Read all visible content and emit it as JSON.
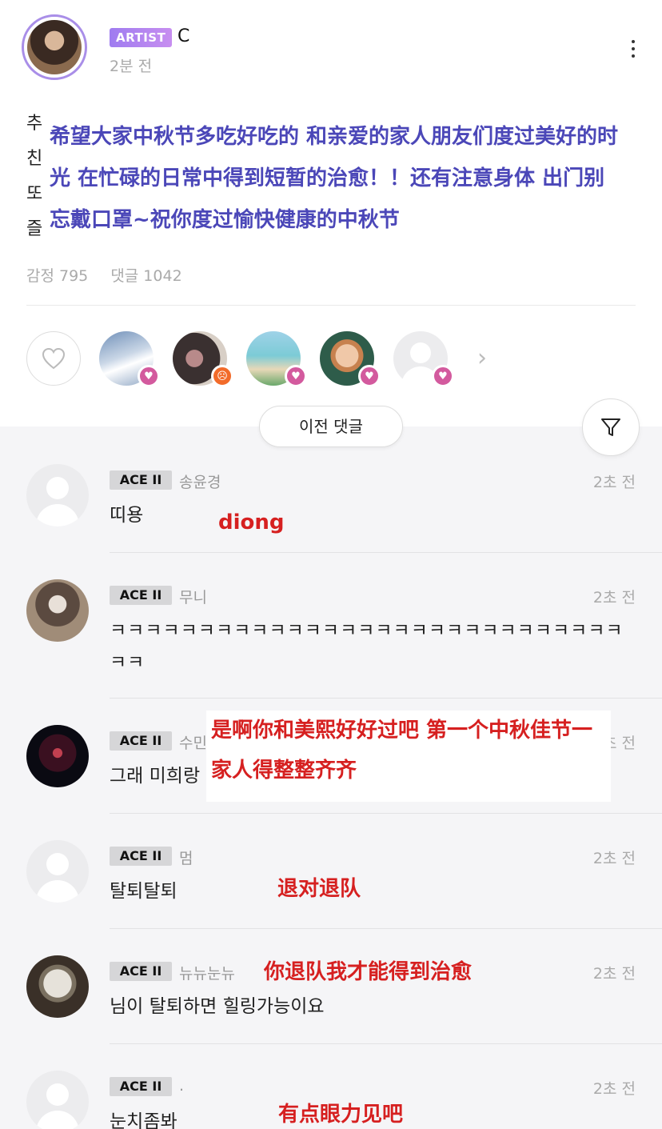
{
  "post": {
    "badge": "ARTIST",
    "author": "C",
    "time": "2분 전",
    "korean_chars": [
      "추",
      "친",
      "또",
      "즐"
    ],
    "translation": "希望大家中秋节多吃好吃的 和亲爱的家人朋友们度过美好的时光 在忙碌的日常中得到短暂的治愈！！还有注意身体 出门别忘戴口罩~祝你度过愉快健康的中秋节",
    "reactions_label": "감정 795",
    "comments_label": "댓글 1042"
  },
  "controls": {
    "previous_comments": "이전 댓글"
  },
  "comments": [
    {
      "level": "ACE II",
      "nick": "송윤경",
      "time": "2초 전",
      "text": "띠용",
      "note": "diong"
    },
    {
      "level": "ACE II",
      "nick": "무니",
      "time": "2초 전",
      "text": "ㅋㅋㅋㅋㅋㅋㅋㅋㅋㅋㅋㅋㅋㅋㅋㅋㅋㅋㅋㅋㅋㅋㅋㅋㅋㅋㅋㅋㅋㅋㅋ"
    },
    {
      "level": "ACE II",
      "nick": "수민",
      "time": "2초 전",
      "text": "그래 미희랑",
      "note": "是啊你和美熙好好过吧 第一个中秋佳节一家人得整整齐齐"
    },
    {
      "level": "ACE II",
      "nick": "멈",
      "time": "2초 전",
      "text": "탈퇴탈퇴",
      "note": "退对退队"
    },
    {
      "level": "ACE II",
      "nick": "뉴뉴눈뉴",
      "time": "2초 전",
      "text": "님이 탈퇴하면 힐링가능이요",
      "note": "你退队我才能得到治愈"
    },
    {
      "level": "ACE II",
      "nick": ".",
      "time": "2초 전",
      "text": "눈치좀봐",
      "note": "有点眼力见吧"
    }
  ],
  "icons": {
    "like": "heart-outline-icon",
    "more": "more-vertical-icon",
    "filter": "filter-icon",
    "next": "chevron-right-icon"
  },
  "colors": {
    "artist_badge": "#a986ee",
    "translation_text": "#4b47b8",
    "note_red": "#d62020",
    "heart_badge": "#d35a9e"
  }
}
